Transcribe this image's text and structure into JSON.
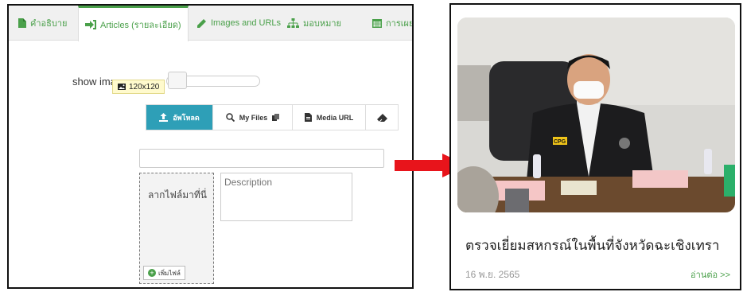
{
  "editor": {
    "tabs": [
      {
        "label": "คำอธิบาย",
        "icon": "file-icon"
      },
      {
        "label": "Articles (รายละเอียด)",
        "icon": "sign-in-icon"
      },
      {
        "label": "Images and URLs",
        "icon": "pencil-icon"
      },
      {
        "label": "มอบหมาย",
        "icon": "sitemap-icon"
      },
      {
        "label": "การเผยแ",
        "icon": "calendar-icon"
      }
    ],
    "active_tab": 1,
    "show_image_label": "show image",
    "image_size_tooltip": "120x120",
    "buttons": {
      "upload": "อัพโหลด",
      "my_files": "My Files",
      "media_url": "Media URL"
    },
    "url_field_value": "",
    "drop_zone_text": "ลากไฟล์มาที่นี่",
    "add_file_label": "เพิ่มไฟล์",
    "description_placeholder": "Description",
    "accent_color": "#4aa04a",
    "upload_color": "#2e9fb7"
  },
  "arrow": {
    "color": "#e8141b"
  },
  "card": {
    "title": "ตรวจเยี่ยมสหกรณ์ในพื้นที่จังหวัดฉะเชิงเทรา",
    "date": "16 พ.ย. 2565",
    "read_more": "อ่านต่อ >>",
    "photo_badge": "CPG"
  }
}
